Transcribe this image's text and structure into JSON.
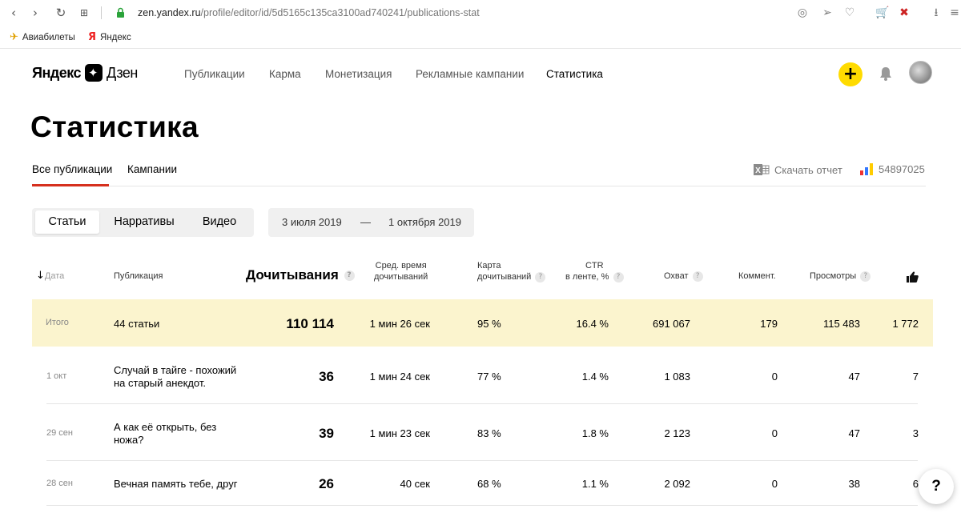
{
  "browser": {
    "url_host": "zen.yandex.ru",
    "url_path": "/profile/editor/id/5d5165c135ca3100ad740241/publications-stat",
    "bookmarks": [
      "Авиабилеты",
      "Яндекс"
    ]
  },
  "header": {
    "logo_brand": "Яндекс",
    "logo_product": "Дзен",
    "nav": [
      "Публикации",
      "Карма",
      "Монетизация",
      "Рекламные кампании",
      "Статистика"
    ],
    "active_nav": "Статистика",
    "plus_label": "+"
  },
  "page": {
    "title": "Статистика",
    "subtabs": [
      "Все публикации",
      "Кампании"
    ],
    "download_label": "Скачать отчет",
    "account_id": "54897025"
  },
  "filters": {
    "segments": [
      "Статьи",
      "Нарративы",
      "Видео"
    ],
    "active_segment": "Статьи",
    "date_from": "3 июля 2019",
    "date_dash": "—",
    "date_to": "1 октября 2019"
  },
  "table": {
    "headers": {
      "date": "Дата",
      "publication": "Публикация",
      "reads": "Дочитывания",
      "avg_time_1": "Сред. время",
      "avg_time_2": "дочитываний",
      "map_1": "Карта",
      "map_2": "дочитываний",
      "ctr_1": "CTR",
      "ctr_2": "в ленте, %",
      "reach": "Охват",
      "comments": "Коммент.",
      "views": "Просмотры",
      "help": "?"
    },
    "total": {
      "label": "Итого",
      "publication": "44 статьи",
      "reads": "110 114",
      "avg_time": "1 мин 26 сек",
      "map": "95 %",
      "ctr": "16.4 %",
      "reach": "691 067",
      "comments": "179",
      "views": "115 483",
      "likes": "1 772"
    },
    "rows": [
      {
        "date": "1 окт",
        "title": "Случай в тайге - похожий на старый анекдот.",
        "reads": "36",
        "avg_time": "1 мин 24 сек",
        "map": "77 %",
        "ctr": "1.4 %",
        "reach": "1 083",
        "comments": "0",
        "views": "47",
        "likes": "7"
      },
      {
        "date": "29 сен",
        "title": "А как её открыть, без ножа?",
        "reads": "39",
        "avg_time": "1 мин 23 сек",
        "map": "83 %",
        "ctr": "1.8 %",
        "reach": "2 123",
        "comments": "0",
        "views": "47",
        "likes": "3"
      },
      {
        "date": "28 сен",
        "title": "Вечная память тебе, друг",
        "reads": "26",
        "avg_time": "40 сек",
        "map": "68 %",
        "ctr": "1.1 %",
        "reach": "2 092",
        "comments": "0",
        "views": "38",
        "likes": "6"
      }
    ]
  },
  "help_button": "?",
  "colors": {
    "accent_yellow": "#ffdb00",
    "tab_underline": "#d6301e",
    "total_row_bg": "#fbf4ce"
  }
}
